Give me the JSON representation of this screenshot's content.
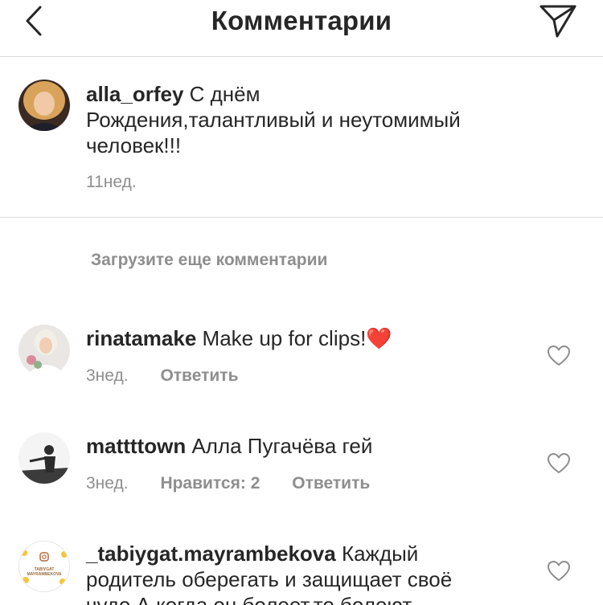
{
  "header": {
    "title": "Комментарии",
    "back_icon": "chevron-left-icon",
    "send_icon": "paper-plane-icon"
  },
  "caption": {
    "username": "alla_orfey",
    "text_line1": "С днём",
    "text_line2": "Рождения,талантливый и неутомимый",
    "text_line3": "человек!!!",
    "time": "11нед."
  },
  "load_more": "Загрузите еще комментарии",
  "comments": [
    {
      "username": "rinatamake",
      "text": "Make up for clips!",
      "emoji": "❤️",
      "time": "3нед.",
      "reply": "Ответить"
    },
    {
      "username": "mattttown",
      "text": "Алла Пугачёва гей",
      "time": "3нед.",
      "likes": "Нравится: 2",
      "reply": "Ответить"
    },
    {
      "username": "_tabiygat.mayrambekova",
      "text_line1": "Каждый",
      "text_line2": "родитель оберегать и защищает своё",
      "text_line3": "чудо.А когда он болеет,то болеют",
      "avatar_text": "_TABIYGAT_ MAYRAMBEKOVA"
    }
  ],
  "colors": {
    "text": "#262626",
    "secondary": "#8e8e8e",
    "divider": "#dbdbdb"
  }
}
